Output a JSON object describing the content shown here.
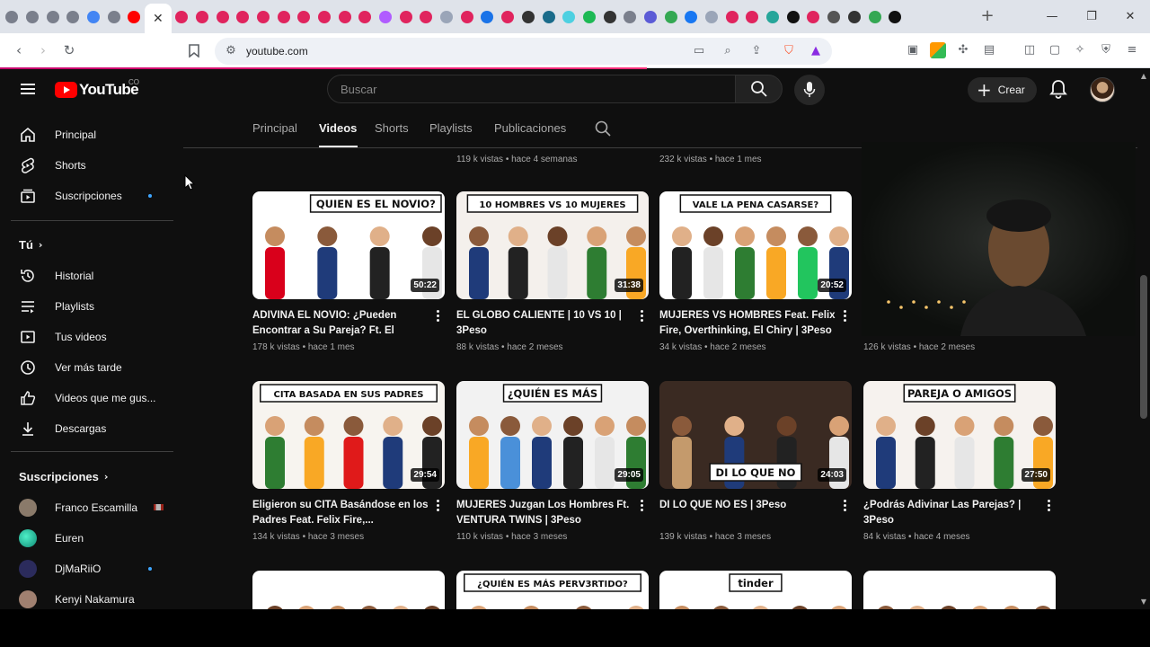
{
  "browser": {
    "active_tab_close": "✕",
    "new_tab": "+",
    "window": {
      "minimize": "—",
      "restore": "❐",
      "close": "✕"
    },
    "url": "youtube.com"
  },
  "youtube": {
    "logo_text": "YouTube",
    "country_code": "CO",
    "search_placeholder": "Buscar",
    "create_label": "Crear",
    "create_plus": "+"
  },
  "sidebar": {
    "main": [
      {
        "label": "Principal",
        "icon": "home-icon"
      },
      {
        "label": "Shorts",
        "icon": "shorts-icon"
      },
      {
        "label": "Suscripciones",
        "icon": "subscriptions-icon"
      }
    ],
    "you_heading": "Tú",
    "you": [
      {
        "label": "Historial",
        "icon": "history-icon"
      },
      {
        "label": "Playlists",
        "icon": "playlists-icon"
      },
      {
        "label": "Tus videos",
        "icon": "your-videos-icon"
      },
      {
        "label": "Ver más tarde",
        "icon": "watch-later-icon"
      },
      {
        "label": "Videos que me gus...",
        "icon": "like-icon"
      },
      {
        "label": "Descargas",
        "icon": "download-icon"
      }
    ],
    "subs_heading": "Suscripciones",
    "subs": [
      {
        "label": "Franco Escamilla",
        "color": "#8a7a6a"
      },
      {
        "label": "Euren",
        "color": "#1fb89a"
      },
      {
        "label": "DjMaRiiO",
        "color": "#3a3a70"
      },
      {
        "label": "Kenyi Nakamura",
        "color": "#a08070"
      }
    ]
  },
  "channel_tabs": [
    "Principal",
    "Videos",
    "Shorts",
    "Playlists",
    "Publicaciones"
  ],
  "top_meta": [
    "119 k vistas • hace 4 semanas",
    "232 k vistas • hace 1 mes"
  ],
  "videos": [
    {
      "title": "ADIVINA EL NOVIO: ¿Pueden Encontrar a Su Pareja? Ft. El Anim...",
      "duration": "50:22",
      "views": "178 k vistas • hace 1 mes",
      "thumb_text": "QUIEN ES EL NOVIO?",
      "bg": "#ffffff",
      "accent": "#d9001b"
    },
    {
      "title": "EL GLOBO CALIENTE | 10 VS 10 | 3Peso",
      "duration": "31:38",
      "views": "88 k vistas • hace 2 meses",
      "thumb_text": "10 HOMBRES VS 10 MUJERES",
      "bg": "#f4f0ec",
      "accent": "#e0004a"
    },
    {
      "title": "MUJERES VS HOMBRES Feat. Felix Fire, Overthinking, El Chiry | 3Peso",
      "duration": "20:52",
      "views": "34 k vistas • hace 2 meses",
      "thumb_text": "VALE LA PENA CASARSE?",
      "bg": "#ffffff",
      "accent": "#22c55e"
    },
    {
      "title": "",
      "duration": "",
      "views": "126 k vistas • hace 2 meses",
      "thumb_text": "",
      "bg": "#1a1a1a",
      "accent": "#6a4a30"
    },
    {
      "title": "Eligieron su CITA Basándose en los Padres Feat. Felix Fire,...",
      "duration": "29:54",
      "views": "134 k vistas • hace 3 meses",
      "thumb_text": "CITA BASADA EN SUS PADRES",
      "bg": "#f7f4ef",
      "accent": "#e01a1a"
    },
    {
      "title": "MUJERES Juzgan Los Hombres Ft. VENTURA TWINS | 3Peso",
      "duration": "29:05",
      "views": "110 k vistas • hace 3 meses",
      "thumb_text": "¿QUIÉN ES MÁS",
      "bg": "#f2f2f2",
      "accent": "#4a90d9"
    },
    {
      "title": "DI LO QUE NO ES | 3Peso",
      "duration": "24:03",
      "views": "139 k vistas • hace 3 meses",
      "thumb_text": "DI LO QUE NO",
      "bg": "#3a2a22",
      "accent": "#c49a6c"
    },
    {
      "title": "¿Podrás Adivinar Las Parejas? | 3Peso",
      "duration": "27:50",
      "views": "84 k vistas • hace 4 meses",
      "thumb_text": "PAREJA O AMIGOS",
      "bg": "#f6f2ee",
      "accent": "#e11d2e"
    },
    {
      "title": "",
      "duration": "",
      "views": "",
      "thumb_text": "",
      "bg": "#ffffff",
      "accent": "#7a4a30"
    },
    {
      "title": "",
      "duration": "",
      "views": "",
      "thumb_text": "¿QUIÉN ES MÁS PERV3RTIDO?",
      "bg": "#ffffff",
      "accent": "#222222"
    },
    {
      "title": "",
      "duration": "",
      "views": "",
      "thumb_text": "tinder",
      "bg": "#ffffff",
      "accent": "#ff4458"
    },
    {
      "title": "",
      "duration": "",
      "views": "",
      "thumb_text": "",
      "bg": "#ffffff",
      "accent": "#5a3a28"
    }
  ]
}
